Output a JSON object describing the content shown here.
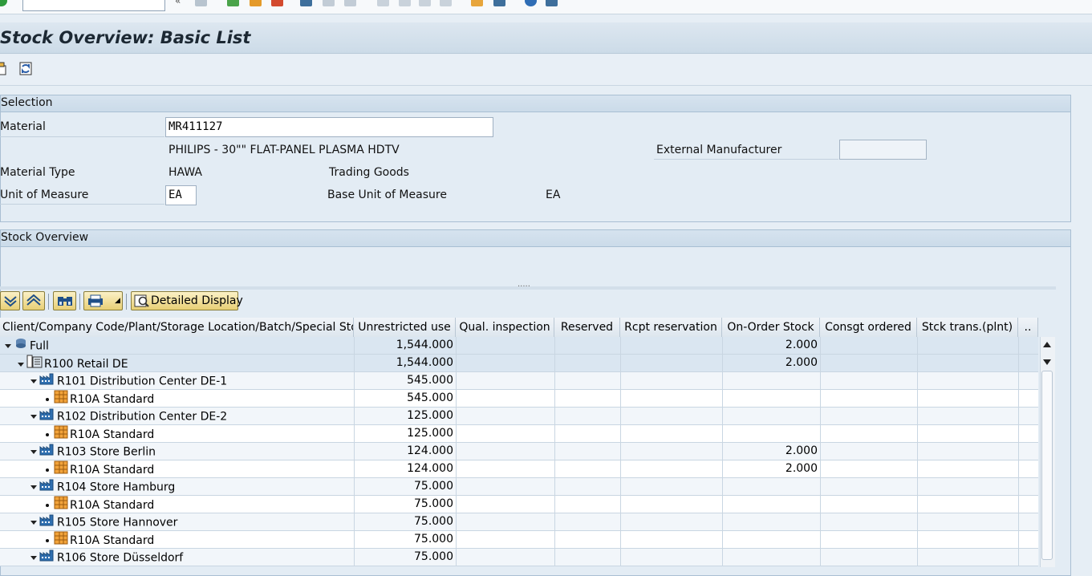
{
  "window": {
    "title": "Stock Overview: Basic List",
    "command_field_value": ""
  },
  "selection": {
    "group_title": "Selection",
    "material_label": "Material",
    "material_value": "MR411127",
    "material_description": "PHILIPS - 30\"\" FLAT-PANEL PLASMA HDTV",
    "external_manufacturer_label": "External Manufacturer",
    "external_manufacturer_value": "",
    "material_type_label": "Material Type",
    "material_type_code": "HAWA",
    "material_type_text": "Trading Goods",
    "uom_label": "Unit of Measure",
    "uom_value": "EA",
    "base_uom_label": "Base Unit of Measure",
    "base_uom_value": "EA"
  },
  "stock_overview": {
    "group_title": "Stock Overview",
    "splitter_dots": ".....",
    "detailed_display_label": "Detailed Display",
    "overflow_label": "..",
    "columns": [
      "Client/Company Code/Plant/Storage Location/Batch/Special Stock",
      "Unrestricted use",
      "Qual. inspection",
      "Reserved",
      "Rcpt reservation",
      "On-Order Stock",
      "Consgt ordered",
      "Stck trans.(plnt)"
    ],
    "rows": [
      {
        "label": "Full",
        "unrestricted": "1,544.000",
        "on_order": "2.000"
      },
      {
        "label": "R100 Retail DE",
        "unrestricted": "1,544.000",
        "on_order": "2.000"
      },
      {
        "label": "R101 Distribution Center DE-1",
        "unrestricted": "545.000",
        "on_order": ""
      },
      {
        "label": "R10A Standard",
        "unrestricted": "545.000",
        "on_order": ""
      },
      {
        "label": "R102 Distribution Center DE-2",
        "unrestricted": "125.000",
        "on_order": ""
      },
      {
        "label": "R10A Standard",
        "unrestricted": "125.000",
        "on_order": ""
      },
      {
        "label": "R103 Store Berlin",
        "unrestricted": "124.000",
        "on_order": "2.000"
      },
      {
        "label": "R10A Standard",
        "unrestricted": "124.000",
        "on_order": "2.000"
      },
      {
        "label": "R104 Store Hamburg",
        "unrestricted": "75.000",
        "on_order": ""
      },
      {
        "label": "R10A Standard",
        "unrestricted": "75.000",
        "on_order": ""
      },
      {
        "label": "R105 Store Hannover",
        "unrestricted": "75.000",
        "on_order": ""
      },
      {
        "label": "R10A Standard",
        "unrestricted": "75.000",
        "on_order": ""
      },
      {
        "label": "R106 Store Düsseldorf",
        "unrestricted": "75.000",
        "on_order": ""
      }
    ]
  },
  "colors": {
    "highlight": "#e6ec00",
    "title_bg": "#d4e1ec",
    "button_gold": "#e8cf75"
  },
  "icons": [
    "confirm-icon",
    "back-icon",
    "save-icon",
    "exit-icon",
    "cancel-icon",
    "print-icon",
    "find-icon",
    "help-icon",
    "layout-icon",
    "expand-all-icon",
    "collapse-all-icon",
    "binoculars-icon",
    "printer-icon",
    "detail-icon",
    "client-icon",
    "company-icon",
    "plant-icon",
    "storage-location-icon"
  ]
}
